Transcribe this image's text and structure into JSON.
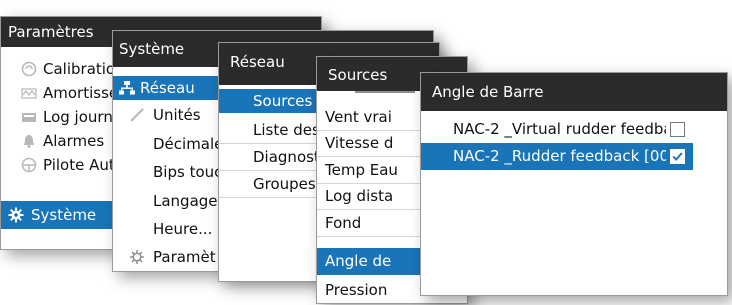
{
  "colors": {
    "title_bar": "#2b2b2b",
    "selection": "#1a74b8",
    "icon_gray": "#b8b8b8"
  },
  "parametres": {
    "title": "Paramètres",
    "items": [
      {
        "label": "Calibration",
        "icon": "compass-icon"
      },
      {
        "label": "Amortisse",
        "icon": "wave-icon"
      },
      {
        "label": "Log journa",
        "icon": "log-icon"
      },
      {
        "label": "Alarmes",
        "icon": "bell-icon"
      },
      {
        "label": "Pilote Aut",
        "icon": "helm-icon"
      },
      {
        "label": "Système",
        "icon": "gear-icon",
        "selected": true
      }
    ]
  },
  "systeme": {
    "title": "Système",
    "items": [
      {
        "label": "Réseau",
        "icon": "network-icon",
        "selected": true
      },
      {
        "label": "Unités",
        "icon": "ruler-icon"
      },
      {
        "label": "Décimale"
      },
      {
        "label": "Bips touc"
      },
      {
        "label": "Langage"
      },
      {
        "label": "Heure..."
      },
      {
        "label": "Paramèt",
        "icon": "settings-cog-icon"
      }
    ]
  },
  "reseau": {
    "title": "Réseau",
    "items": [
      {
        "label": "Sources",
        "selected": true
      },
      {
        "label": "Liste des"
      },
      {
        "label": "Diagnost"
      },
      {
        "label": "Groupes"
      }
    ]
  },
  "sources": {
    "title": "Sources",
    "items": [
      {
        "label": "Vent vrai"
      },
      {
        "label": "Vitesse d"
      },
      {
        "label": "Temp Eau"
      },
      {
        "label": "Log dista"
      },
      {
        "label": "Fond"
      },
      {
        "label": "Angle de",
        "selected": true
      },
      {
        "label": "Pression"
      }
    ]
  },
  "angle": {
    "title": "Angle de Barre",
    "items": [
      {
        "label": "NAC-2 _Virtual rudder feedba",
        "checked": false
      },
      {
        "label": "NAC-2 _Rudder feedback [00",
        "checked": true,
        "selected": true
      }
    ]
  }
}
